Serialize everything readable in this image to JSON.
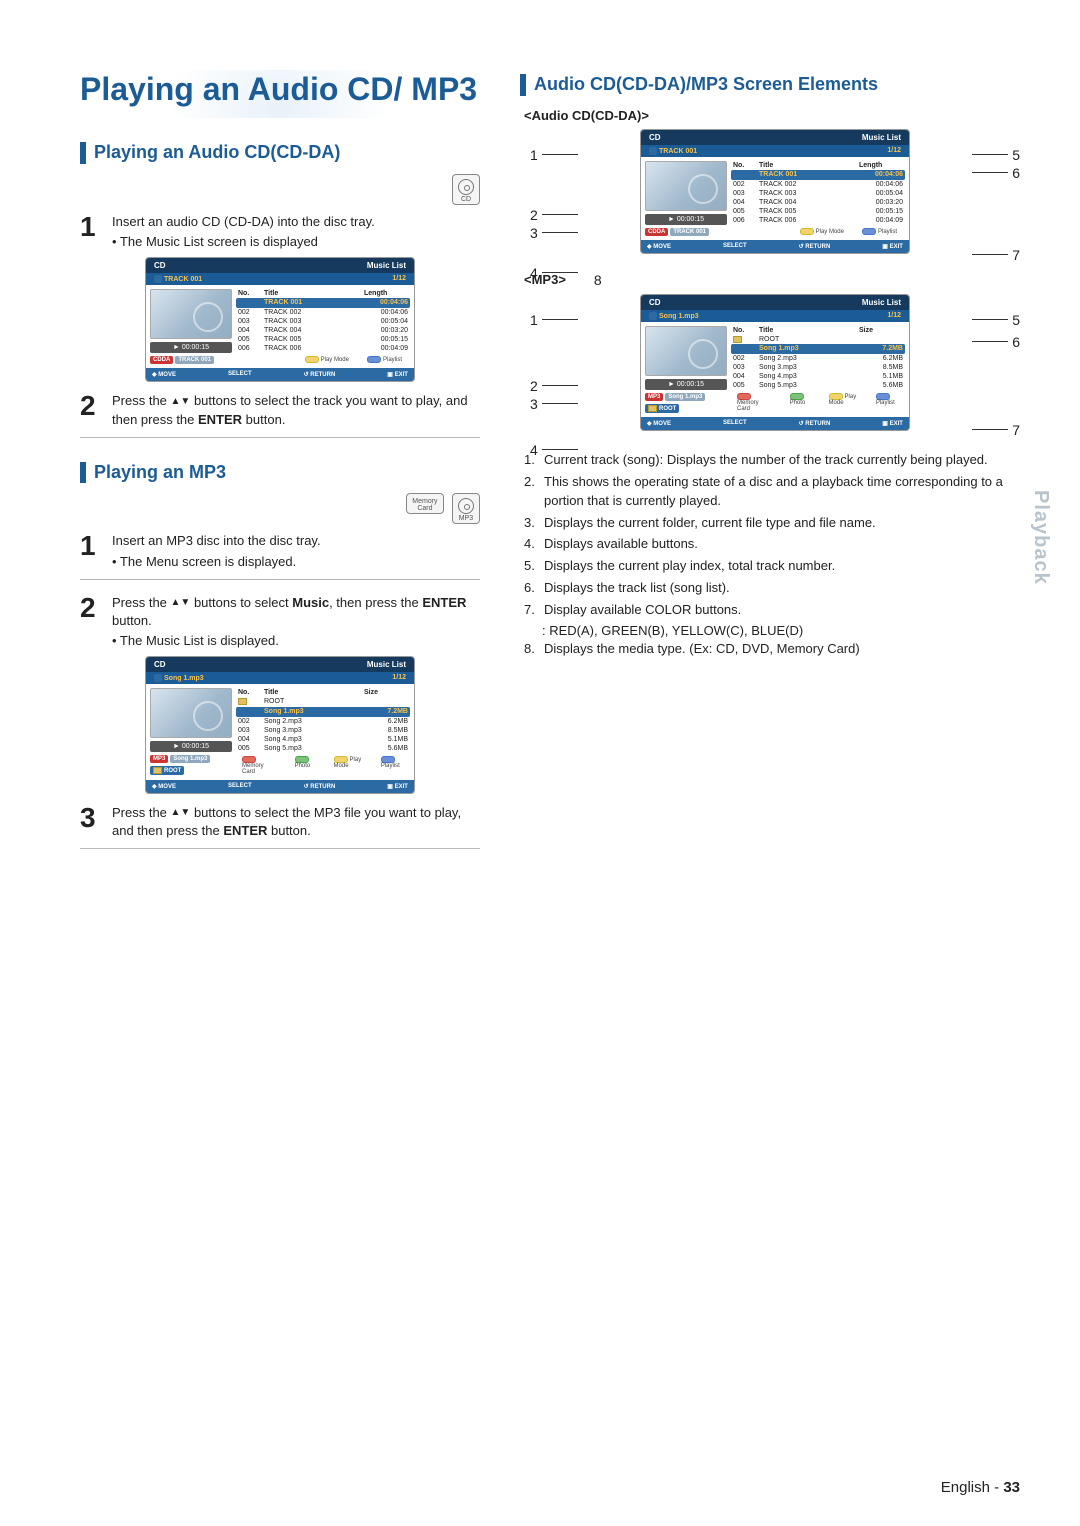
{
  "mainTitle": "Playing an Audio CD/ MP3",
  "sideTab": "Playback",
  "footer": {
    "lang": "English",
    "page": "33"
  },
  "iconLabels": {
    "cd": "CD",
    "mp3": "MP3",
    "memory": "Memory\nCard"
  },
  "sectionA": {
    "heading": "Playing an Audio CD(CD-DA)",
    "step1": "Insert an audio CD (CD-DA) into the disc tray.",
    "step1sub": "• The Music List screen is displayed",
    "step2": "Press the ▲▼ buttons to select the track you want to play, and then press the ENTER button."
  },
  "sectionB": {
    "heading": "Playing an MP3",
    "step1": "Insert an MP3 disc into the disc tray.",
    "step1sub": "• The Menu screen is displayed.",
    "step2a": "Press the ▲▼ buttons to select Music, then press the ENTER button.",
    "step2b": "• The Music List is displayed.",
    "step3": "Press the ▲▼ buttons to select the MP3 file you want to play, and then press the ENTER button."
  },
  "sectionC": {
    "heading": "Audio CD(CD-DA)/MP3 Screen Elements",
    "audioLabel": "<Audio CD(CD-DA)>",
    "mp3Label": "<MP3>"
  },
  "panelCD": {
    "headerLeft": "CD",
    "headerRight": "Music List",
    "subLeft": "TRACK 001",
    "subRight": "1/12",
    "playTime": "00:00:15",
    "tagType": "CDDA",
    "tagTrack": "TRACK 001",
    "cols": [
      "No.",
      "Title",
      "Length"
    ],
    "rows": [
      [
        "",
        "TRACK 001",
        "00:04:06"
      ],
      [
        "002",
        "TRACK 002",
        "00:04:06"
      ],
      [
        "003",
        "TRACK 003",
        "00:05:04"
      ],
      [
        "004",
        "TRACK 004",
        "00:03:20"
      ],
      [
        "005",
        "TRACK 005",
        "00:05:15"
      ],
      [
        "006",
        "TRACK 006",
        "00:04:09"
      ]
    ],
    "pmRow": {
      "a": "Play Mode",
      "b": "Playlist"
    },
    "foot": {
      "move": "MOVE",
      "select": "SELECT",
      "return": "RETURN",
      "exit": "EXIT"
    }
  },
  "panelMP3": {
    "headerLeft": "CD",
    "headerRight": "Music List",
    "subLeft": "Song 1.mp3",
    "subRight": "1/12",
    "playTime": "00:00:15",
    "tagType": "MP3",
    "tagTrack": "Song 1.mp3",
    "rootLabel": "ROOT",
    "cols": [
      "No.",
      "Title",
      "Size"
    ],
    "rows": [
      [
        "",
        "ROOT",
        ""
      ],
      [
        "",
        "Song 1.mp3",
        "7.2MB"
      ],
      [
        "002",
        "Song 2.mp3",
        "6.2MB"
      ],
      [
        "003",
        "Song 3.mp3",
        "8.5MB"
      ],
      [
        "004",
        "Song 4.mp3",
        "5.1MB"
      ],
      [
        "005",
        "Song 5.mp3",
        "5.6MB"
      ]
    ],
    "pmRowFull": {
      "a": "Memory Card",
      "b": "Photo",
      "c": "Play Mode",
      "d": "Playlist"
    },
    "foot": {
      "move": "MOVE",
      "select": "SELECT",
      "return": "RETURN",
      "exit": "EXIT"
    }
  },
  "descriptions": [
    "Current track (song): Displays the number of the track currently being played.",
    "This shows the operating state of a disc and a playback time corresponding to a portion that is currently played.",
    "Displays the current folder, current file type and file name.",
    "Displays available buttons.",
    "Displays the current play index, total track number.",
    "Displays the track list (song list).",
    "Display available COLOR buttons.",
    "Displays the media type. (Ex: CD, DVD, Memory Card)"
  ],
  "desc7sub": ": RED(A), GREEN(B), YELLOW(C), BLUE(D)"
}
